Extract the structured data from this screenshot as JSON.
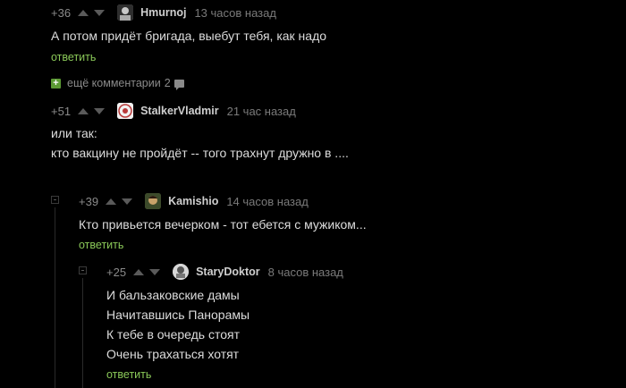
{
  "comments": [
    {
      "rating": "+36",
      "author": "Hmurnoj",
      "time": "13 часов назад",
      "lines": [
        "А потом придёт бригада, выебут тебя, как надо"
      ],
      "reply_label": "ответить"
    },
    {
      "rating": "+51",
      "author": "StalkerVladmir",
      "time": "21 час назад",
      "lines": [
        "или так:",
        "кто вакцину не пройдёт -- того трахнут дружно в ...."
      ]
    },
    {
      "rating": "+39",
      "author": "Kamishio",
      "time": "14 часов назад",
      "lines": [
        "Кто привьется вечерком - тот ебется с мужиком..."
      ],
      "reply_label": "ответить"
    },
    {
      "rating": "+25",
      "author": "StaryDoktor",
      "time": "8 часов назад",
      "lines": [
        "И бальзаковские дамы",
        "Начитавшись Панорамы",
        "К тебе в очередь стоят",
        "Очень трахаться хотят"
      ],
      "reply_label": "ответить"
    }
  ],
  "more_comments": {
    "label": "ещё комментарии",
    "count": "2",
    "icon": "plus-box-icon"
  },
  "icons": {
    "upvote": "arrow-up-icon",
    "downvote": "arrow-down-icon",
    "collapse": "collapse-box-icon",
    "comments": "chat-bubble-icon"
  },
  "colors": {
    "background": "#000000",
    "reply_link": "#8ac858",
    "plus_box": "#5c9a34"
  }
}
